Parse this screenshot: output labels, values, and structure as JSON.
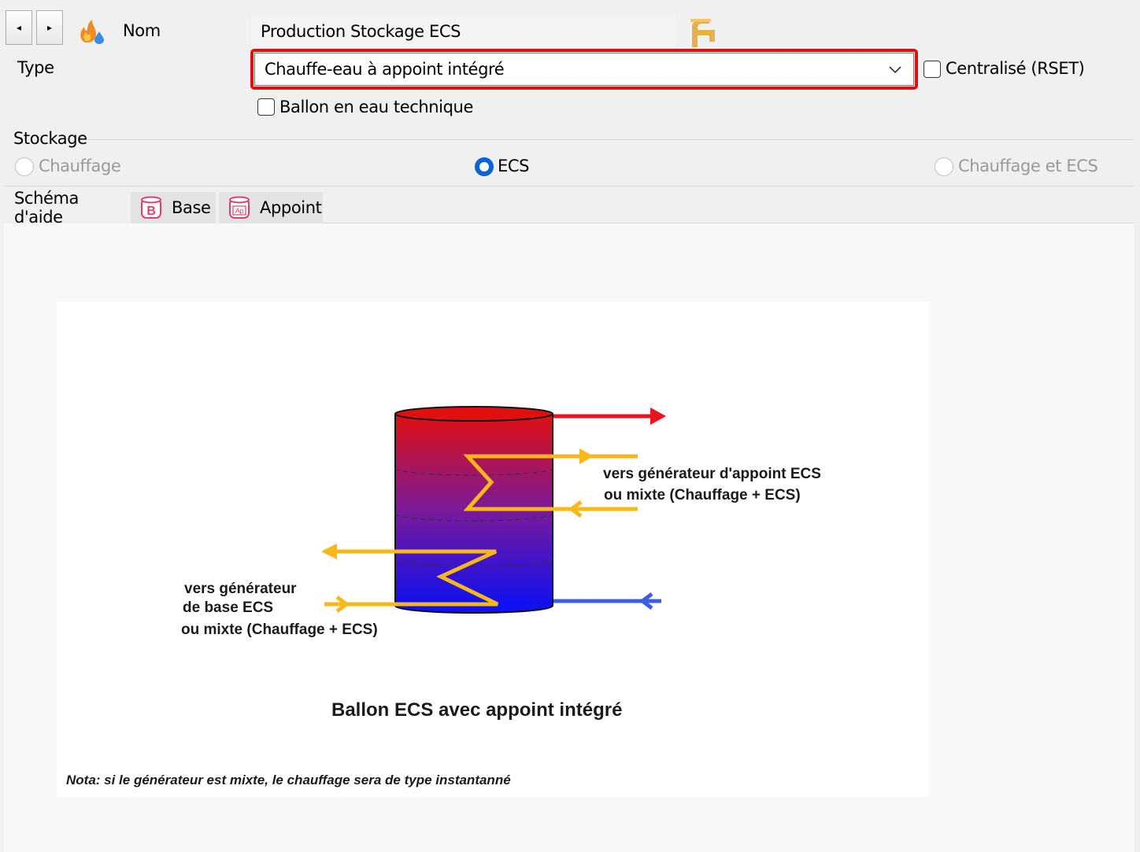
{
  "header": {
    "nav_prev_glyph": "◂",
    "nav_next_glyph": "▸",
    "app_icon": "flame-water-icon",
    "name_label": "Nom",
    "name_value": "Production Stockage ECS",
    "faucet_icon": "faucet-icon"
  },
  "type_row": {
    "label": "Type",
    "selected": "Chauffe-eau à appoint intégré",
    "centralise_label": "Centralisé (RSET)",
    "centralise_checked": false,
    "highlight_color": "#e01010"
  },
  "ballon_label": "Ballon en eau technique",
  "ballon_checked": false,
  "stockage": {
    "title": "Stockage",
    "options": [
      {
        "label": "Chauffage",
        "selected": false,
        "enabled": false
      },
      {
        "label": "ECS",
        "selected": true,
        "enabled": true
      },
      {
        "label": "Chauffage et ECS",
        "selected": false,
        "enabled": false
      }
    ]
  },
  "tabs": [
    {
      "label": "Schéma d'aide",
      "active": true,
      "icon": ""
    },
    {
      "label": "Base",
      "active": false,
      "icon": "base-b-icon"
    },
    {
      "label": "Appoint",
      "active": false,
      "icon": "appoint-ap-icon"
    }
  ],
  "diagram": {
    "right_label_1": "vers générateur d'appoint ECS",
    "right_label_2": "ou mixte (Chauffage + ECS)",
    "left_label_1": "vers générateur",
    "left_label_2": "de base  ECS",
    "left_label_3": "ou mixte (Chauffage + ECS)",
    "title": "Ballon ECS avec appoint intégré",
    "note": "Nota: si le générateur  est mixte, le chauffage sera de type instantanné",
    "colors": {
      "hot": "#e8141c",
      "cold": "#3a5fe0",
      "coil": "#f6b81a",
      "tank_top": "#e01010",
      "tank_bottom": "#1010f0"
    }
  }
}
